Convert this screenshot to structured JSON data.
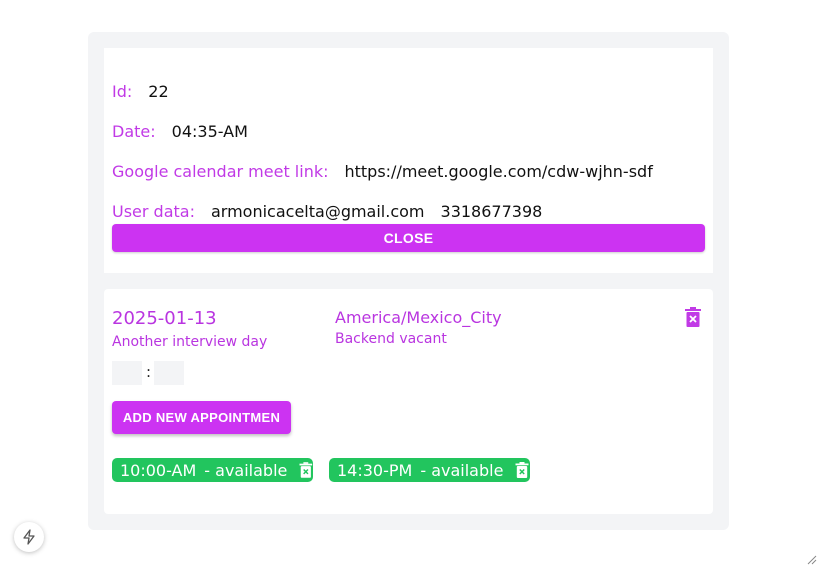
{
  "details": {
    "id_label": "Id:",
    "id_value": "22",
    "date_label": "Date:",
    "date_value": "04:35-AM",
    "meet_label": "Google calendar meet link:",
    "meet_value": "https://meet.google.com/cdw-wjhn-sdf",
    "user_label": "User data:",
    "user_email": "armonicacelta@gmail.com",
    "user_phone": "3318677398",
    "close_label": "CLOSE"
  },
  "day": {
    "date": "2025-01-13",
    "subtitle": "Another interview day",
    "timezone": "America/Mexico_City",
    "vacancy": "Backend vacant",
    "time_separator": ":",
    "add_label": "ADD NEW APPOINTMEN",
    "slots": [
      {
        "time": "10:00-AM",
        "status": "- available"
      },
      {
        "time": "14:30-PM",
        "status": "- available"
      }
    ]
  },
  "colors": {
    "accent": "#cc33f2",
    "label": "#c13ae6",
    "available": "#22c55e",
    "panel": "#f3f4f6"
  },
  "icons": [
    "trash-icon",
    "bolt-icon",
    "resize-handle-icon"
  ]
}
